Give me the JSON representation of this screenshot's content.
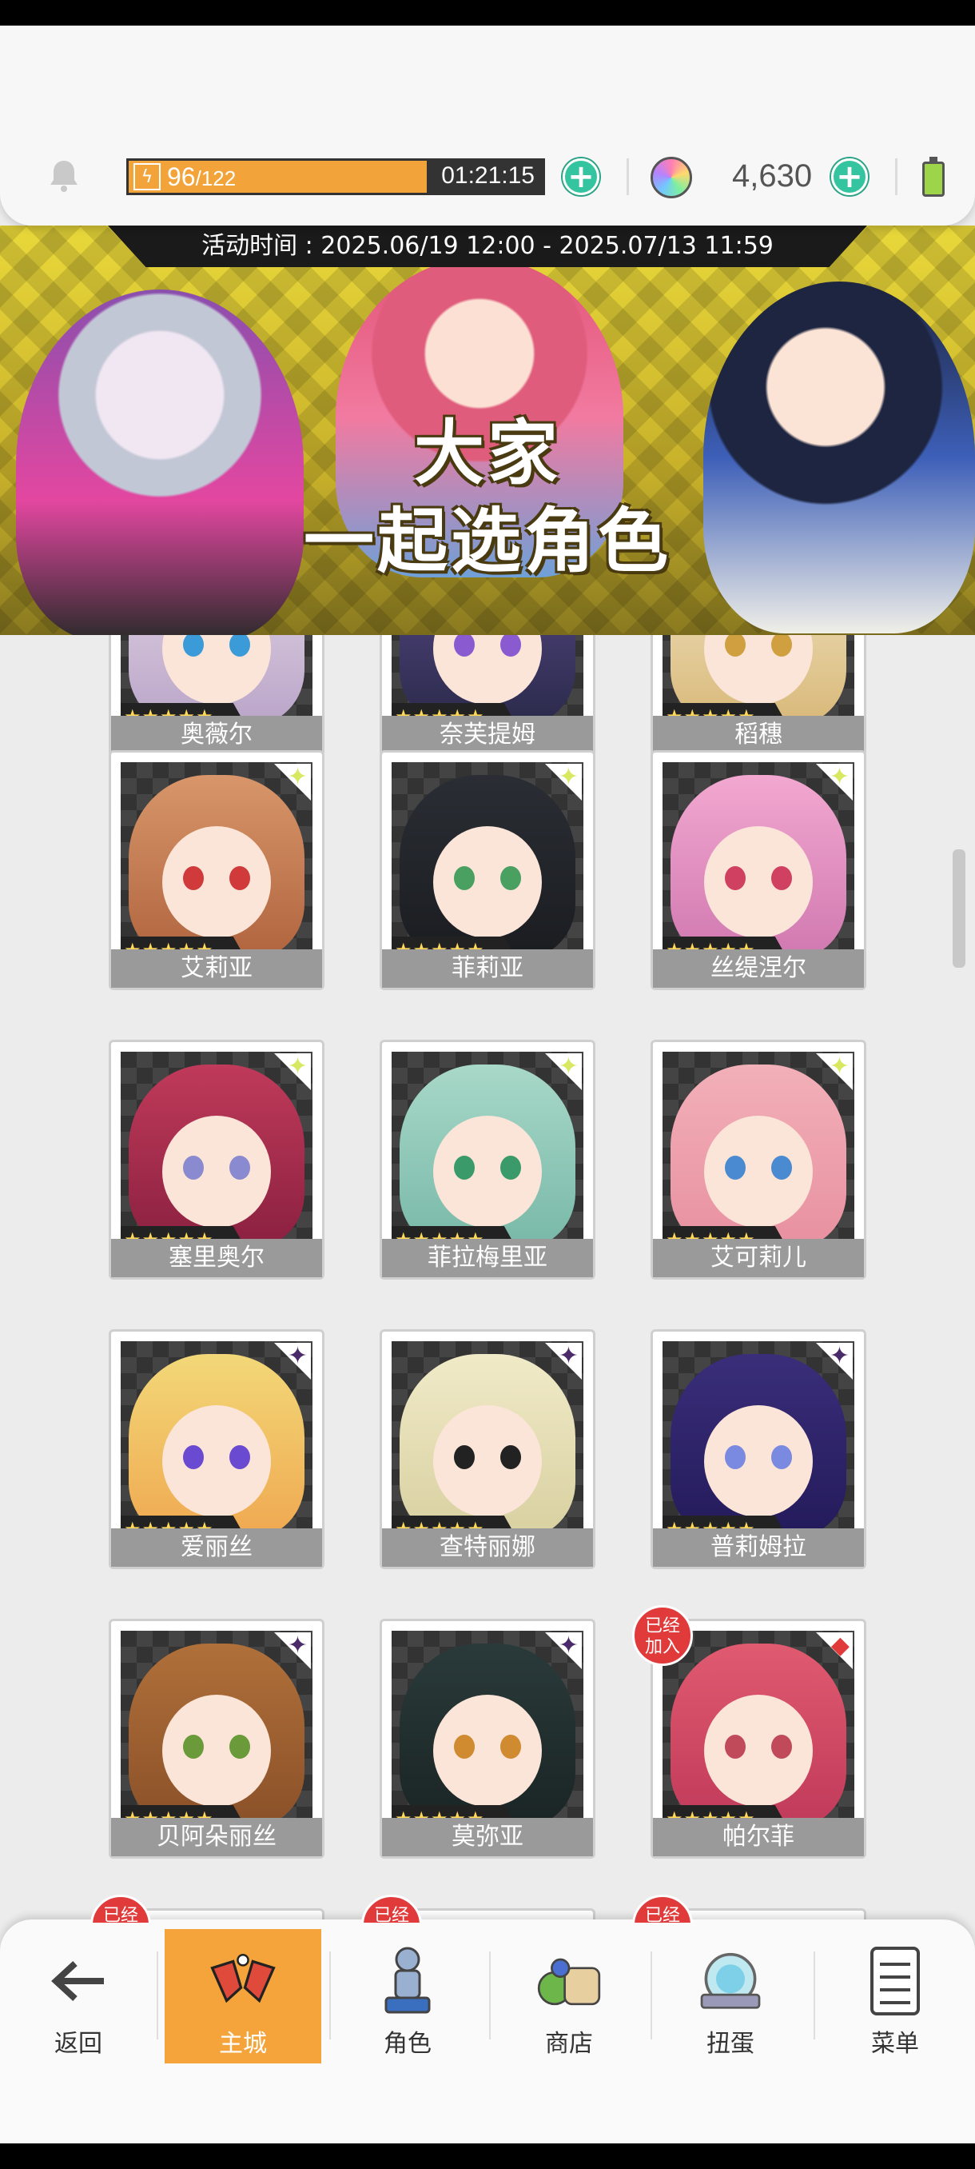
{
  "header": {
    "stamina_current": "96",
    "stamina_max": "/122",
    "stamina_timer": "01:21:15",
    "gem_count": "4,630"
  },
  "banner": {
    "event_time": "活动时间 : 2025.06/19 12:00 - 2025.07/13 11:59",
    "title_line1": "大家",
    "title_line2": "一起选角色"
  },
  "characters": [
    {
      "name": "奥薇尔",
      "stars": "★★★★★",
      "element": "",
      "joined": ""
    },
    {
      "name": "奈芙提姆",
      "stars": "★★★★★",
      "element": "",
      "joined": ""
    },
    {
      "name": "稻穗",
      "stars": "★★★★★",
      "element": "",
      "joined": ""
    },
    {
      "name": "艾莉亚",
      "stars": "★★★★★",
      "element": "✦",
      "joined": ""
    },
    {
      "name": "菲莉亚",
      "stars": "★★★★★",
      "element": "✦",
      "joined": ""
    },
    {
      "name": "丝缇涅尔",
      "stars": "★★★★★",
      "element": "✦",
      "joined": ""
    },
    {
      "name": "塞里奥尔",
      "stars": "★★★★★",
      "element": "✦",
      "joined": ""
    },
    {
      "name": "菲拉梅里亚",
      "stars": "★★★★★",
      "element": "✦",
      "joined": ""
    },
    {
      "name": "艾可莉儿",
      "stars": "★★★★★",
      "element": "✦",
      "joined": ""
    },
    {
      "name": "爱丽丝",
      "stars": "★★★★★",
      "element": "✦",
      "joined": ""
    },
    {
      "name": "查特丽娜",
      "stars": "★★★★★",
      "element": "✦",
      "joined": ""
    },
    {
      "name": "普莉姆拉",
      "stars": "★★★★★",
      "element": "✦",
      "joined": ""
    },
    {
      "name": "贝阿朵丽丝",
      "stars": "★★★★★",
      "element": "✦",
      "joined": ""
    },
    {
      "name": "莫弥亚",
      "stars": "★★★★★",
      "element": "✦",
      "joined": ""
    },
    {
      "name": "帕尔菲",
      "stars": "★★★★★",
      "element": "◆",
      "joined": "已经\n加入"
    },
    {
      "name": "",
      "stars": "",
      "element": "",
      "joined": "已经"
    },
    {
      "name": "",
      "stars": "",
      "element": "",
      "joined": "已经"
    },
    {
      "name": "",
      "stars": "",
      "element": "",
      "joined": "已经"
    }
  ],
  "nav": {
    "back": "返回",
    "main_city": "主城",
    "character": "角色",
    "shop": "商店",
    "gacha": "扭蛋",
    "menu": "菜单"
  },
  "icons": {
    "bell": "bell-icon",
    "bolt": "lightning-icon",
    "gem": "gem-icon",
    "battery": "battery-icon"
  },
  "colors": {
    "stamina": "#f2a43a",
    "plus": "#34c4a0",
    "nav_active": "#f4a43a",
    "name_bar": "#9a9a9a",
    "joined_badge": "#e03a3a"
  }
}
